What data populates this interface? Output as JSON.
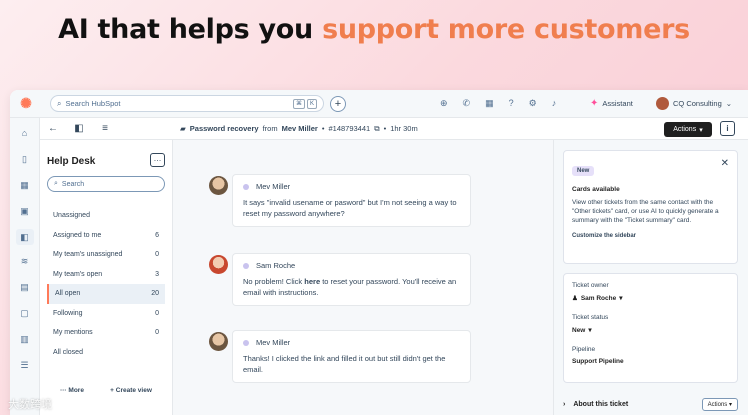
{
  "headline": {
    "part1": "AI that helps you ",
    "accent": "support more customers"
  },
  "topbar": {
    "search_placeholder": "Search HubSpot",
    "kbd": [
      "⌘",
      "K"
    ],
    "assistant": "Assistant",
    "account": "CQ Consulting"
  },
  "subbar": {
    "ticket_name": "Password recovery",
    "from": "from",
    "contact": "Mev Miller",
    "ticket_id": "#148793441",
    "sep": "•",
    "duration": "1hr 30m",
    "actions": "Actions"
  },
  "helpdesk": {
    "title": "Help Desk",
    "search_placeholder": "Search",
    "items": [
      {
        "label": "Unassigned",
        "count": ""
      },
      {
        "label": "Assigned to me",
        "count": "6"
      },
      {
        "label": "My team's unassigned",
        "count": "0"
      },
      {
        "label": "My team's open",
        "count": "3"
      },
      {
        "label": "All open",
        "count": "20"
      },
      {
        "label": "Following",
        "count": "0"
      },
      {
        "label": "My mentions",
        "count": "0"
      },
      {
        "label": "All closed",
        "count": ""
      }
    ],
    "more": "More",
    "create_view": "Create view"
  },
  "messages": [
    {
      "author": "Mev Miller",
      "text": "It says \"invalid usename or pasword\" but I'm not seeing a way to reset my password anywhere?"
    },
    {
      "author": "Sam Roche",
      "text_pre": "No problem! Click ",
      "link": "here",
      "text_post": " to reset your password. You'll receive an email with instructions."
    },
    {
      "author": "Mev Miller",
      "text": "Thanks! I clicked the link and filled it out but still didn't get the email."
    }
  ],
  "right_panel": {
    "badge": "New",
    "card_title": "Cards available",
    "card_text": "View other tickets from the same contact with the \"Other tickets\" card, or use AI to quickly generate a summary with the \"Ticket summary\" card.",
    "card_link": "Customize the sidebar",
    "fields": [
      {
        "label": "Ticket owner",
        "value": "Sam Roche"
      },
      {
        "label": "Ticket status",
        "value": "New"
      },
      {
        "label": "Pipeline",
        "value": "Support Pipeline"
      }
    ],
    "about": "About this ticket",
    "about_actions": "Actions"
  },
  "watermark": "大数跨境",
  "colors": {
    "accent": "#f07e4e",
    "brand": "#ff7a59"
  }
}
